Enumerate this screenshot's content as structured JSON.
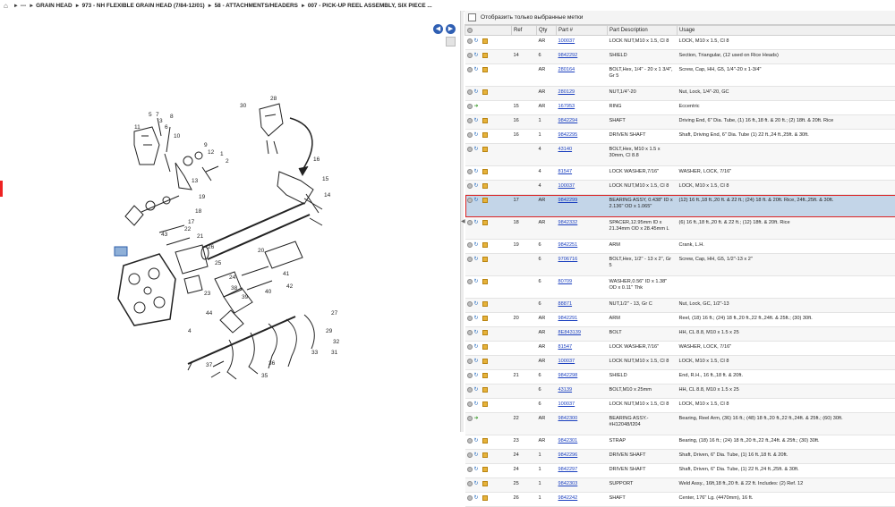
{
  "breadcrumb": {
    "home_icon": "home-icon",
    "items": [
      "---",
      "GRAIN HEAD",
      "973 - NH FLEXIBLE GRAIN HEAD (7/84-12/01)",
      "58 - ATTACHMENTS/HEADERS",
      "007 - PICK-UP REEL ASSEMBLY, SIX PIECE ..."
    ]
  },
  "diagram": {
    "nav_back": "◀",
    "nav_forward": "▶",
    "callouts": [
      "5",
      "7",
      "8",
      "3",
      "11",
      "6",
      "10",
      "9",
      "12",
      "1",
      "2",
      "30",
      "28",
      "16",
      "15",
      "14",
      "13",
      "19",
      "18",
      "17",
      "22",
      "21",
      "20",
      "26",
      "25",
      "24",
      "23",
      "4",
      "27",
      "29",
      "32",
      "31",
      "33",
      "35",
      "36",
      "37",
      "38",
      "39",
      "40",
      "41",
      "42",
      "43",
      "44"
    ]
  },
  "filter": {
    "label": "Отобразить только выбранные метки",
    "checked": false
  },
  "table": {
    "headers": [
      "",
      "Ref",
      "Qty",
      "Part #",
      "Part Description",
      "Usage"
    ],
    "rows": [
      {
        "ref": "",
        "qty": "AR",
        "part": "100037",
        "desc": "LOCK NUT,M10 x 1.5, Cl 8",
        "usage": "LOCK,  M10 x 1.5, Cl 8",
        "icon": "box",
        "h": 1
      },
      {
        "ref": "14",
        "qty": "6",
        "part": "9842292",
        "desc": "SHIELD",
        "usage": "Section, Triangular, (12 used on Rice Heads)",
        "icon": "box",
        "h": 1
      },
      {
        "ref": "",
        "qty": "AR",
        "part": "280164",
        "desc": "BOLT,Hex, 1/4\" - 20 x 1 3/4\", Gr 5",
        "usage": "Screw, Cap, HH, G5, 1/4\"-20 x 1-3/4\"",
        "icon": "box",
        "h": 2
      },
      {
        "ref": "",
        "qty": "AR",
        "part": "280129",
        "desc": "NUT,1/4\"-20",
        "usage": "Nut, Lock,  1/4\"-20, GC",
        "icon": "box",
        "h": 1
      },
      {
        "ref": "15",
        "qty": "AR",
        "part": "167953",
        "desc": "RING",
        "usage": "Eccentric",
        "icon": "green",
        "h": 1
      },
      {
        "ref": "16",
        "qty": "1",
        "part": "9842294",
        "desc": "SHAFT",
        "usage": "Driving End, 6\" Dia. Tube, (1) 16 ft.,18 ft. & 20 ft.; (2) 18ft. & 20ft. Rice",
        "icon": "box",
        "h": 1
      },
      {
        "ref": "16",
        "qty": "1",
        "part": "9842295",
        "desc": "DRIVEN SHAFT",
        "usage": "Shaft, Driving End, 6\" Dia. Tube (1) 22 ft.,24 ft.,25ft. & 30ft.",
        "icon": "box",
        "h": 1
      },
      {
        "ref": "",
        "qty": "4",
        "part": "43140",
        "desc": "BOLT,Hex, M10 x 1.5 x 30mm, Cl 8.8",
        "usage": "",
        "icon": "box",
        "h": 2
      },
      {
        "ref": "",
        "qty": "4",
        "part": "81547",
        "desc": "LOCK WASHER,7/16\"",
        "usage": "WASHER, LOCK,  7/16\"",
        "icon": "box",
        "h": 1
      },
      {
        "ref": "",
        "qty": "4",
        "part": "100037",
        "desc": "LOCK NUT,M10 x 1.5, Cl 8",
        "usage": "LOCK,  M10 x 1.5, Cl 8",
        "icon": "box",
        "h": 1
      },
      {
        "ref": "17",
        "qty": "AR",
        "part": "9842299",
        "desc": "BEARING ASSY, 0.438\" ID x 2.136\" OD x 1.065\"",
        "usage": "(12) 16 ft.,18 ft.,20 ft. & 22 ft.; (24) 18 ft. & 20ft. Rice, 24ft.,25ft. & 30ft.",
        "icon": "box",
        "h": 2,
        "selected": true
      },
      {
        "ref": "18",
        "qty": "AR",
        "part": "9842332",
        "desc": "SPACER,12.95mm ID x 21.34mm OD x 28.45mm L",
        "usage": "(6) 16 ft.,18 ft.,20 ft. & 22 ft.; (12) 18ft. & 20ft. Rice",
        "icon": "box",
        "h": 2
      },
      {
        "ref": "19",
        "qty": "6",
        "part": "9842251",
        "desc": "ARM",
        "usage": "Crank, L.H.",
        "icon": "box",
        "h": 1
      },
      {
        "ref": "",
        "qty": "6",
        "part": "9706716",
        "desc": "BOLT,Hex, 1/2\" - 13 x 2\", Gr 5",
        "usage": "Screw, Cap, HH, G5, 1/2\"-13 x 2\"",
        "icon": "box",
        "h": 2
      },
      {
        "ref": "",
        "qty": "6",
        "part": "80709",
        "desc": "WASHER,0.56\" ID x 1.38\" OD x 0.11\" Thk",
        "usage": "",
        "icon": "box",
        "h": 2
      },
      {
        "ref": "",
        "qty": "6",
        "part": "88871",
        "desc": "NUT,1/2\" - 13, Gr C",
        "usage": "Nut, Lock, GC, 1/2\"-13",
        "icon": "box",
        "h": 1
      },
      {
        "ref": "20",
        "qty": "AR",
        "part": "9842291",
        "desc": "ARM",
        "usage": "Reel, (18) 16 ft.; (24) 18 ft.,20 ft.,22 ft.,24ft. & 25ft.; (30) 30ft.",
        "icon": "box",
        "h": 1
      },
      {
        "ref": "",
        "qty": "AR",
        "part": "8E843139",
        "desc": "BOLT",
        "usage": "HH, CL 8.8, M10 x 1.5 x 25",
        "icon": "box",
        "h": 1
      },
      {
        "ref": "",
        "qty": "AR",
        "part": "81547",
        "desc": "LOCK WASHER,7/16\"",
        "usage": "WASHER, LOCK,  7/16\"",
        "icon": "box",
        "h": 1
      },
      {
        "ref": "",
        "qty": "AR",
        "part": "100037",
        "desc": "LOCK NUT,M10 x 1.5, Cl 8",
        "usage": "LOCK,  M10 x 1.5, Cl 8",
        "icon": "box",
        "h": 1
      },
      {
        "ref": "21",
        "qty": "6",
        "part": "9842298",
        "desc": "SHIELD",
        "usage": "End, R.H., 16 ft.,18 ft. & 20ft.",
        "icon": "box",
        "h": 1
      },
      {
        "ref": "",
        "qty": "6",
        "part": "43139",
        "desc": "BOLT,M10 x 25mm",
        "usage": "HH, CL 8.8, M10 x 1.5 x 25",
        "icon": "box",
        "h": 1
      },
      {
        "ref": "",
        "qty": "6",
        "part": "100037",
        "desc": "LOCK NUT,M10 x 1.5, Cl 8",
        "usage": "LOCK,  M10 x 1.5, Cl 8",
        "icon": "box",
        "h": 1
      },
      {
        "ref": "22",
        "qty": "AR",
        "part": "9842300",
        "desc": "BEARING ASSY.-#H12048/I204",
        "usage": "Bearing, Reel Arm, (36) 16 ft.; (48) 18 ft.,20 ft.,22 ft.,24ft. & 25ft.; (60) 30ft.",
        "icon": "green",
        "h": 2
      },
      {
        "ref": "23",
        "qty": "AR",
        "part": "9842301",
        "desc": "STRAP",
        "usage": "Bearing, (18) 16 ft.; (24) 18 ft.,20 ft.,22 ft.,24ft. & 25ft.; (30) 30ft.",
        "icon": "box",
        "h": 1
      },
      {
        "ref": "24",
        "qty": "1",
        "part": "9842296",
        "desc": "DRIVEN SHAFT",
        "usage": "Shaft, Driven, 6\" Dia. Tube, (1) 16 ft.,18 ft. & 20ft.",
        "icon": "box",
        "h": 1
      },
      {
        "ref": "24",
        "qty": "1",
        "part": "9842297",
        "desc": "DRIVEN SHAFT",
        "usage": "Shaft, Driven, 6\" Dia. Tube, (1) 22 ft.,24 ft.,25ft. & 30ft.",
        "icon": "box",
        "h": 1
      },
      {
        "ref": "25",
        "qty": "1",
        "part": "9842303",
        "desc": "SUPPORT",
        "usage": "Weld Assy., 16ft,18 ft.,20 ft. & 22 ft. Includes: (2) Ref. 12",
        "icon": "box",
        "h": 1
      },
      {
        "ref": "26",
        "qty": "1",
        "part": "9842242",
        "desc": "SHAFT",
        "usage": "Center, 176\" Lg. (4470mm), 16 ft.",
        "icon": "box",
        "h": 1
      }
    ]
  }
}
